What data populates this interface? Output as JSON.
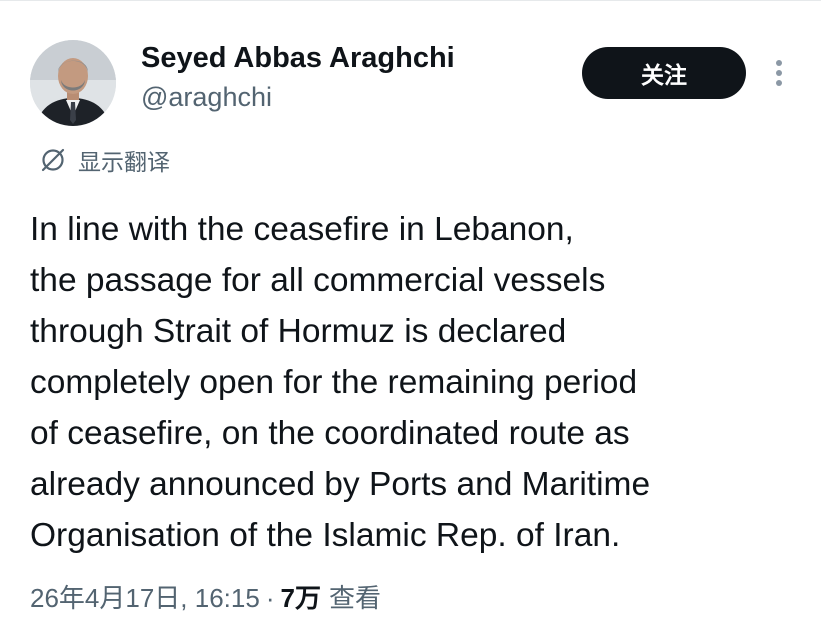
{
  "author": {
    "display_name": "Seyed Abbas Araghchi",
    "handle": "@araghchi",
    "avatar_icon": "profile-photo"
  },
  "actions": {
    "follow_label": "关注",
    "more_icon": "more-vertical-icon"
  },
  "translate": {
    "label": "显示翻译",
    "icon": "globe-icon"
  },
  "tweet": {
    "lines": [
      "In line with the ceasefire in Lebanon,",
      "the passage for all commercial vessels",
      "through Strait of Hormuz is declared",
      "completely open for the remaining period",
      "of ceasefire, on the coordinated route as",
      "already announced by Ports and Maritime",
      "Organisation of the Islamic Rep. of Iran."
    ]
  },
  "meta": {
    "timestamp": "26年4月17日, 16:15",
    "separator": "·",
    "views_count": "7万",
    "views_label": "查看"
  },
  "colors": {
    "text_primary": "#0f1419",
    "text_secondary": "#536471",
    "button_bg": "#0f1419",
    "button_text": "#ffffff"
  }
}
